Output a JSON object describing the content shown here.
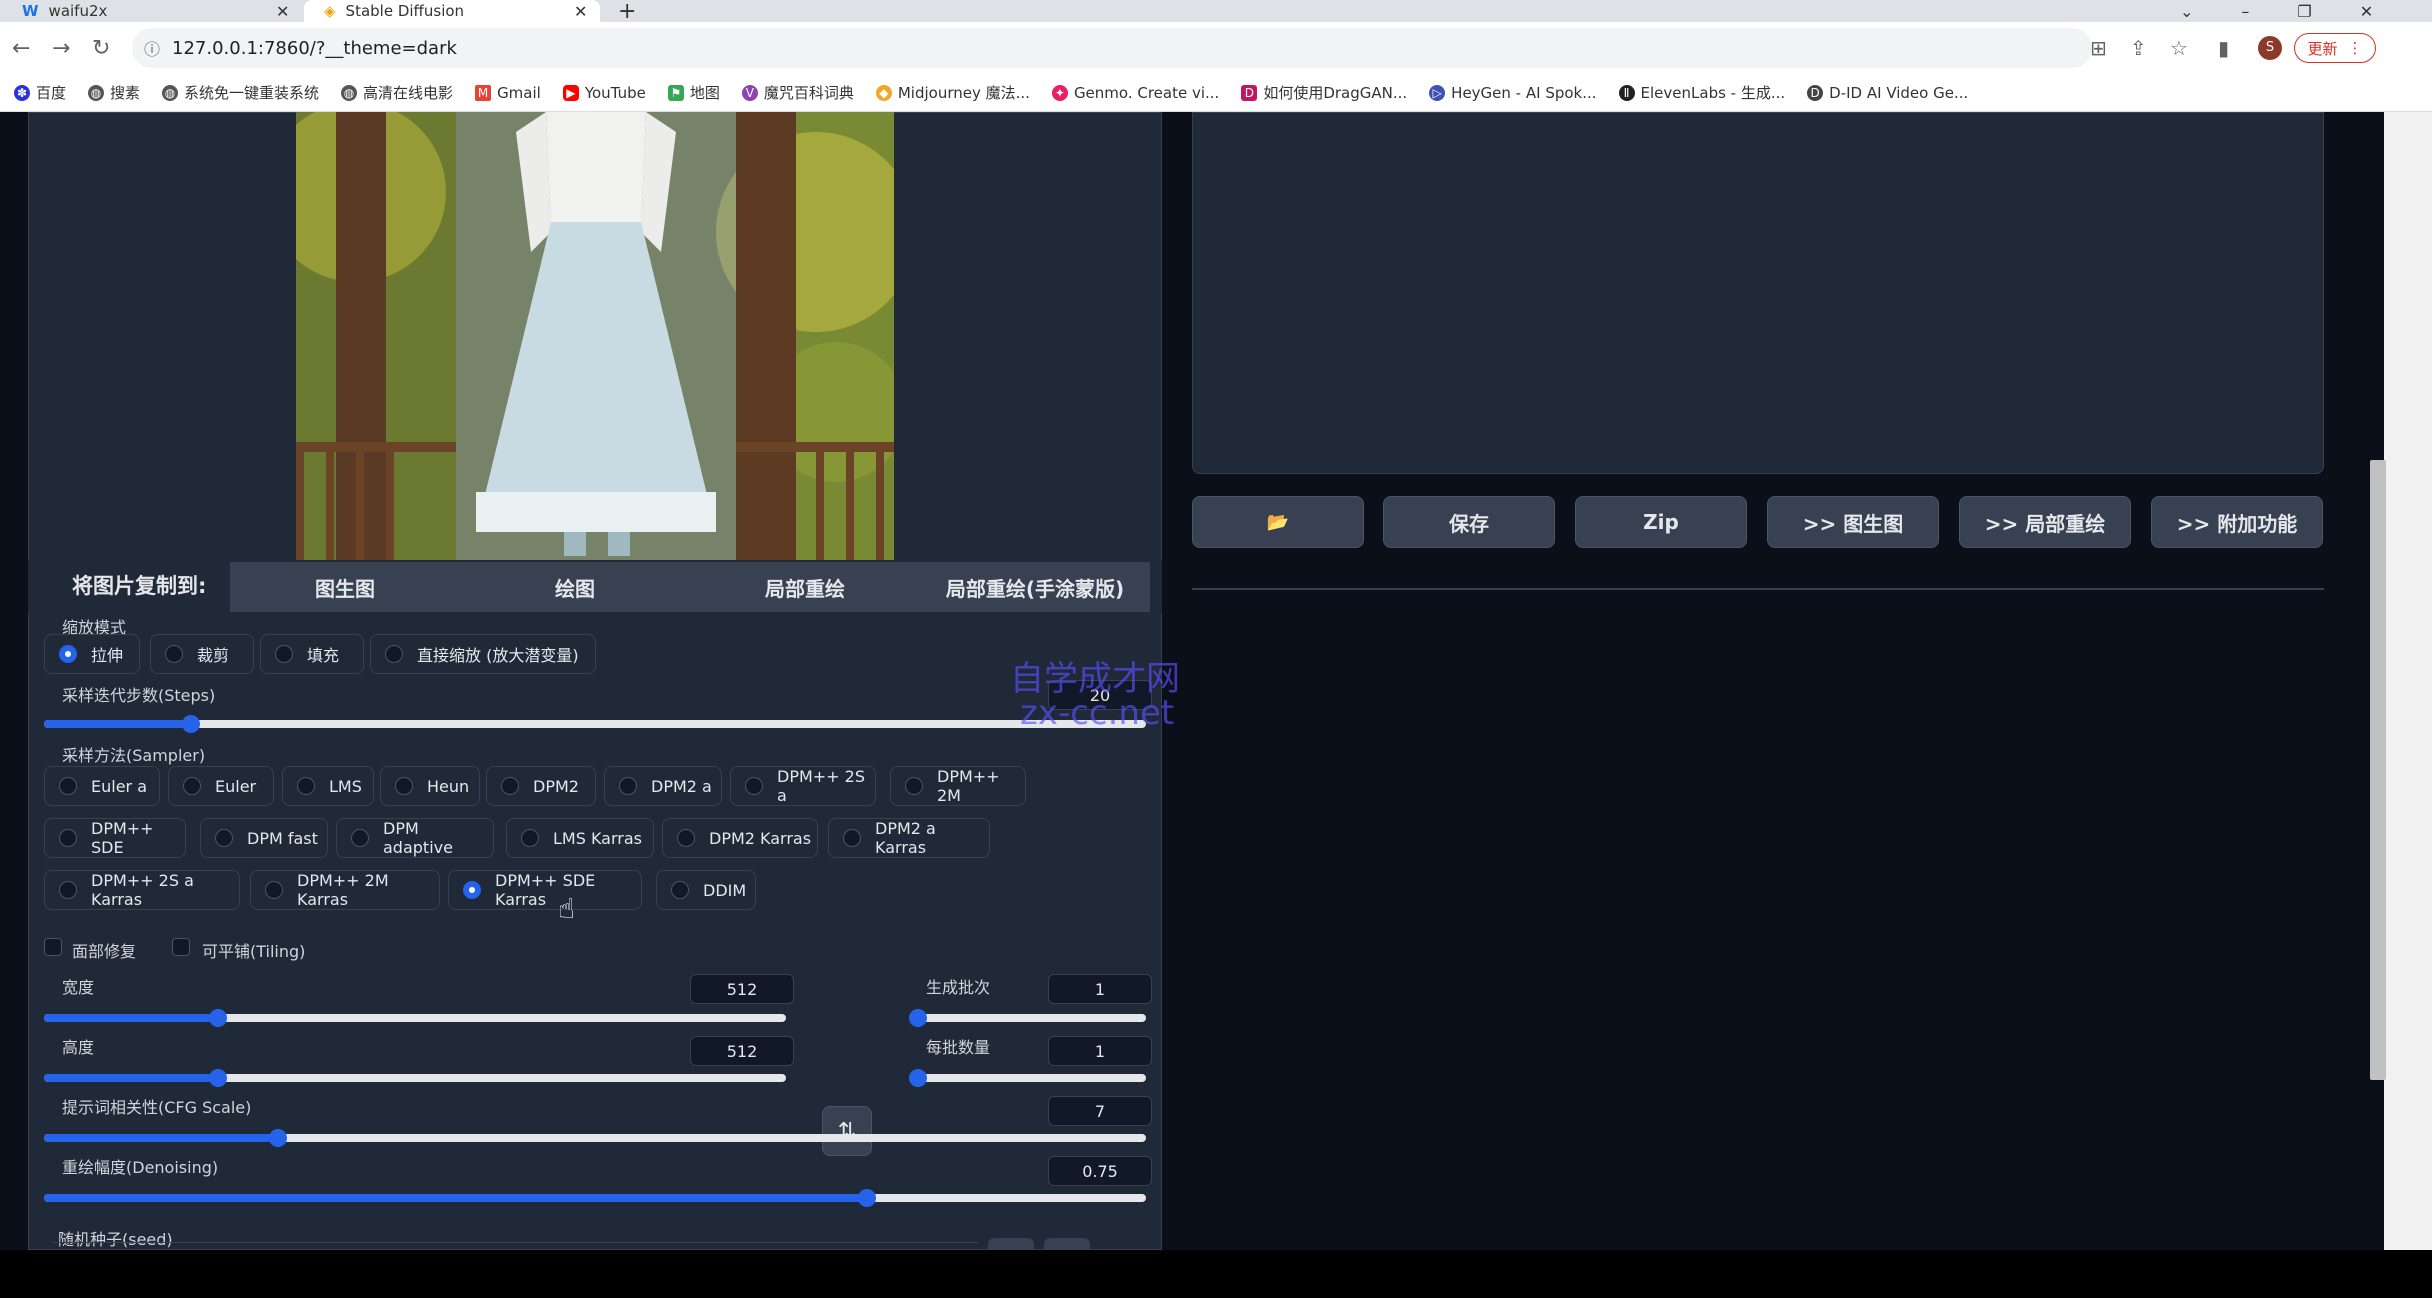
{
  "browser": {
    "tabs": [
      {
        "title": "waifu2x",
        "active": false
      },
      {
        "title": "Stable Diffusion",
        "active": true
      }
    ],
    "new_tab": "+",
    "url": "127.0.0.1:7860/?__theme=dark",
    "update_label": "更新",
    "profile_initial": "S",
    "bookmarks": [
      "百度",
      "搜素",
      "系统免一键重装系统",
      "高清在线电影",
      "Gmail",
      "YouTube",
      "地图",
      "魔咒百科词典",
      "Midjourney 魔法...",
      "Genmo. Create vi...",
      "如何使用DragGAN...",
      "HeyGen - AI Spok...",
      "ElevenLabs - 生成...",
      "D-ID AI Video Ge..."
    ]
  },
  "output": {
    "buttons": [
      "📂",
      "保存",
      "Zip",
      ">> 图生图",
      ">> 局部重绘",
      ">> 附加功能"
    ]
  },
  "copy_to": {
    "label": "将图片复制到:",
    "targets": [
      "图生图",
      "绘图",
      "局部重绘",
      "局部重绘(手涂蒙版)"
    ]
  },
  "resize_mode": {
    "label": "缩放模式",
    "options": [
      "拉伸",
      "裁剪",
      "填充",
      "直接缩放 (放大潜变量)"
    ],
    "selected": "拉伸"
  },
  "steps": {
    "label": "采样迭代步数(Steps)",
    "value": "20",
    "fraction": 0.133
  },
  "sampler": {
    "label": "采样方法(Sampler)",
    "row1": [
      "Euler a",
      "Euler",
      "LMS",
      "Heun",
      "DPM2",
      "DPM2 a",
      "DPM++ 2S a",
      "DPM++ 2M"
    ],
    "row2": [
      "DPM++ SDE",
      "DPM fast",
      "DPM adaptive",
      "LMS Karras",
      "DPM2 Karras",
      "DPM2 a Karras"
    ],
    "row3": [
      "DPM++ 2S a Karras",
      "DPM++ 2M Karras",
      "DPM++ SDE Karras",
      "DDIM"
    ],
    "selected": "DPM++ SDE Karras"
  },
  "checkboxes": {
    "restore_faces": "面部修复",
    "tiling": "可平铺(Tiling)"
  },
  "width": {
    "label": "宽度",
    "value": "512",
    "fraction": 0.235
  },
  "height": {
    "label": "高度",
    "value": "512",
    "fraction": 0.235
  },
  "batch_count": {
    "label": "生成批次",
    "value": "1",
    "fraction": 0.0
  },
  "batch_size": {
    "label": "每批数量",
    "value": "1",
    "fraction": 0.0
  },
  "cfg": {
    "label": "提示词相关性(CFG Scale)",
    "value": "7",
    "fraction": 0.212
  },
  "denoising": {
    "label": "重绘幅度(Denoising)",
    "value": "0.75",
    "fraction": 0.747
  },
  "seed": {
    "label": "随机种子(seed)"
  },
  "watermark": {
    "line1": "自学成才网",
    "line2": "zx-cc.net"
  }
}
